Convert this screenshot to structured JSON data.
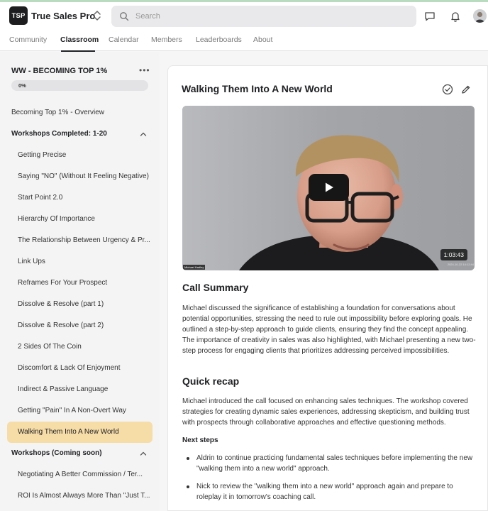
{
  "app": {
    "logo_text": "TSP",
    "name": "True Sales Pro",
    "switcher_icon": "chevron-up-down-icon"
  },
  "search": {
    "placeholder": "Search",
    "icon": "search-icon"
  },
  "header_icons": [
    "chat-icon",
    "bell-icon",
    "avatar"
  ],
  "nav": {
    "tabs": [
      {
        "label": "Community",
        "active": false
      },
      {
        "label": "Classroom",
        "active": true
      },
      {
        "label": "Calendar",
        "active": false
      },
      {
        "label": "Members",
        "active": false
      },
      {
        "label": "Leaderboards",
        "active": false
      },
      {
        "label": "About",
        "active": false
      }
    ]
  },
  "course": {
    "title": "WW - BECOMING TOP 1%",
    "more_label": "•••",
    "progress_value": 0,
    "progress_label": "0%"
  },
  "sidebar": {
    "overview": "Becoming Top 1% - Overview",
    "sections": [
      {
        "title": "Workshops Completed: 1-20",
        "expanded": true,
        "items": [
          "Getting Precise",
          "Saying \"NO\" (Without It Feeling Negative)",
          "Start Point 2.0",
          "Hierarchy Of Importance",
          "The Relationship Between Urgency & Pr...",
          "Link Ups",
          "Reframes For Your Prospect",
          "Dissolve & Resolve (part 1)",
          "Dissolve & Resolve (part 2)",
          "2 Sides Of The Coin",
          "Discomfort & Lack Of Enjoyment",
          "Indirect & Passive Language",
          "Getting \"Pain\" In A Non-Overt Way",
          "Walking Them Into A New World"
        ],
        "active_item": "Walking Them Into A New World"
      },
      {
        "title": "Workshops (Coming soon)",
        "expanded": true,
        "items": [
          "Negotiating A Better Commission / Ter...",
          "ROI Is Almost Always More Than \"Just T..."
        ]
      }
    ]
  },
  "lesson": {
    "title": "Walking Them Into A New World",
    "action_icons": [
      "check-circle-icon",
      "pencil-icon"
    ],
    "video": {
      "duration": "1:03:43",
      "speaker_tag": "Michael Hadley",
      "timestamp_tag": "2024-10-22 14:12:44"
    },
    "call_summary": {
      "heading": "Call Summary",
      "text": "Michael discussed the significance of establishing a foundation for conversations about potential opportunities, stressing the need to rule out impossibility before exploring goals. He outlined a step-by-step approach to guide clients, ensuring they find the concept appealing. The importance of creativity in sales was also highlighted, with Michael presenting a new two-step process for engaging clients that prioritizes addressing perceived impossibilities."
    },
    "quick_recap": {
      "heading": "Quick recap",
      "text": "Michael introduced the call focused on enhancing sales techniques. The workshop covered strategies for creating dynamic sales experiences, addressing skepticism, and building trust with prospects through collaborative approaches and effective questioning methods."
    },
    "next_steps": {
      "heading": "Next steps",
      "items": [
        "Aldrin to continue practicing fundamental sales techniques before implementing the new \"walking them into a new world\" approach.",
        "Nick to review the \"walking them into a new world\" approach again and prepare to roleplay it in tomorrow's coaching call."
      ]
    }
  },
  "colors": {
    "active_item_bg": "#f6dca7",
    "header_accent": "#b9dcc0",
    "progress_track": "#e3e3e6",
    "play_button": "#161616"
  }
}
